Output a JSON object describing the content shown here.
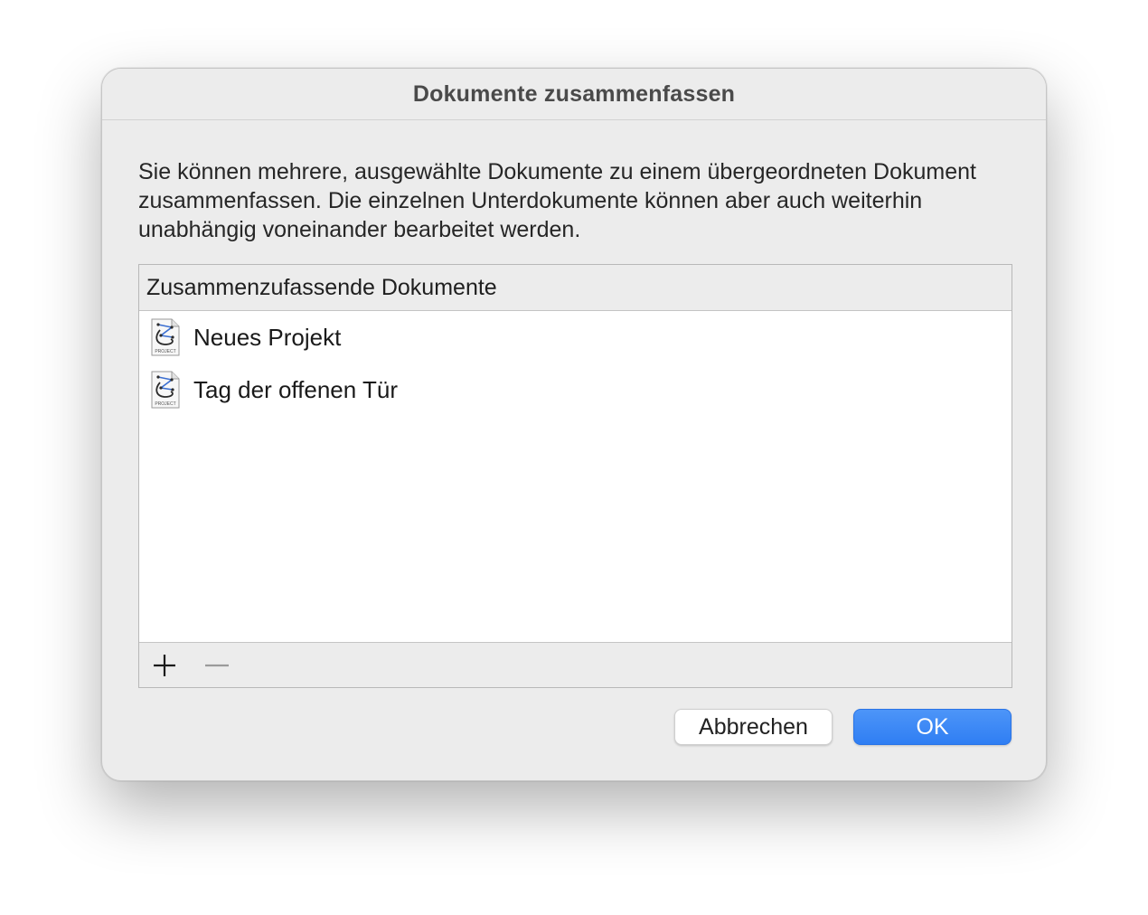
{
  "dialog": {
    "title": "Dokumente zusammenfassen",
    "description": "Sie können mehrere, ausgewählte Dokumente zu einem übergeordneten Dokument zusammenfassen. Die einzelnen Unterdokumente können aber auch weiterhin unabhängig voneinander bearbeitet werden."
  },
  "table": {
    "header": "Zusammenzufassende Dokumente",
    "rows": [
      {
        "label": "Neues Projekt",
        "icon": "project-file-icon",
        "icon_caption": "PROJECT"
      },
      {
        "label": "Tag der offenen Tür",
        "icon": "project-file-icon",
        "icon_caption": "PROJECT"
      }
    ],
    "footer": {
      "add_icon": "plus-icon",
      "remove_icon": "minus-icon"
    }
  },
  "buttons": {
    "cancel_label": "Abbrechen",
    "ok_label": "OK"
  },
  "colors": {
    "accent": "#3a86f5",
    "window_bg": "#ececec"
  }
}
